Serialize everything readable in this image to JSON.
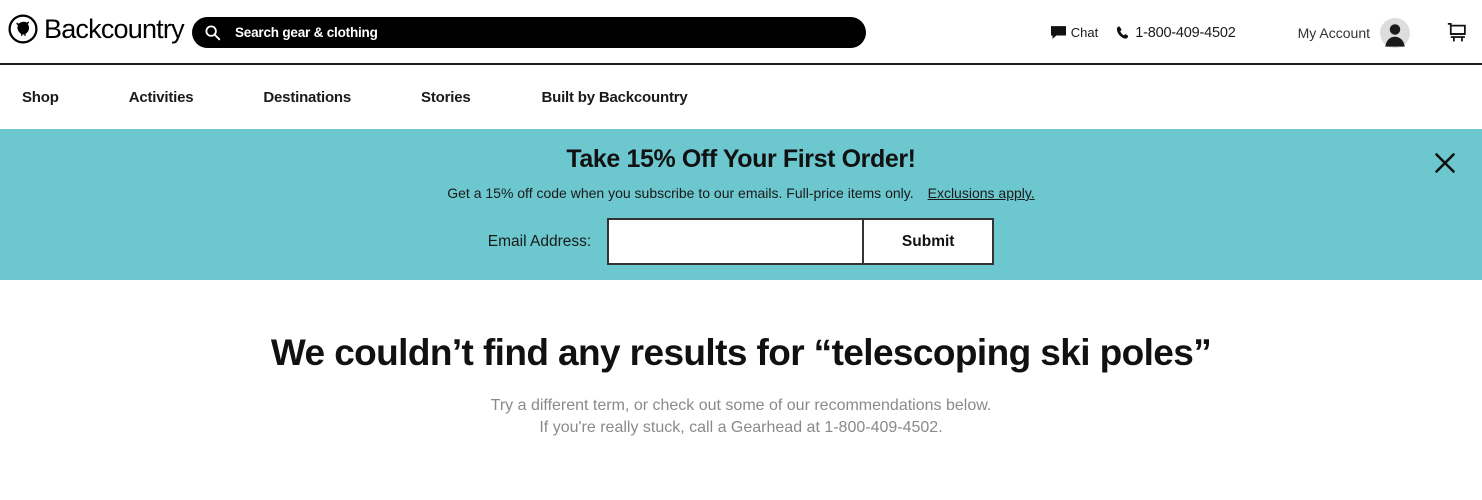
{
  "header": {
    "logo": {
      "icon": "backcountry-goat-logo-icon",
      "text": "Backcountry"
    },
    "search": {
      "icon": "search-icon",
      "placeholder": "Search gear & clothing",
      "value": ""
    },
    "chat": {
      "icon": "chat-bubble-icon",
      "label": "Chat"
    },
    "phone": {
      "icon": "phone-icon",
      "label": "1-800-409-4502"
    },
    "account": {
      "label": "My Account",
      "avatar_icon": "user-avatar-icon"
    },
    "cart": {
      "icon": "shopping-cart-icon"
    }
  },
  "nav": {
    "items": [
      {
        "label": "Shop"
      },
      {
        "label": "Activities"
      },
      {
        "label": "Destinations"
      },
      {
        "label": "Stories"
      },
      {
        "label": "Built by Backcountry"
      }
    ]
  },
  "promo": {
    "title": "Take 15% Off Your First Order!",
    "subtitle": "Get a 15% off code when you subscribe to our emails. Full-price items only.",
    "exclusions_link": "Exclusions apply.",
    "email_label": "Email Address:",
    "email_value": "",
    "email_placeholder": "",
    "submit_label": "Submit",
    "close_icon": "close-icon",
    "background_color": "#6cc7ce"
  },
  "main": {
    "no_results_title": "We couldn’t find any results for “telescoping ski poles”",
    "no_results_line1": "Try a different term, or check out some of our recommendations below.",
    "no_results_line2": "If you're really stuck, call a Gearhead at 1-800-409-4502."
  }
}
